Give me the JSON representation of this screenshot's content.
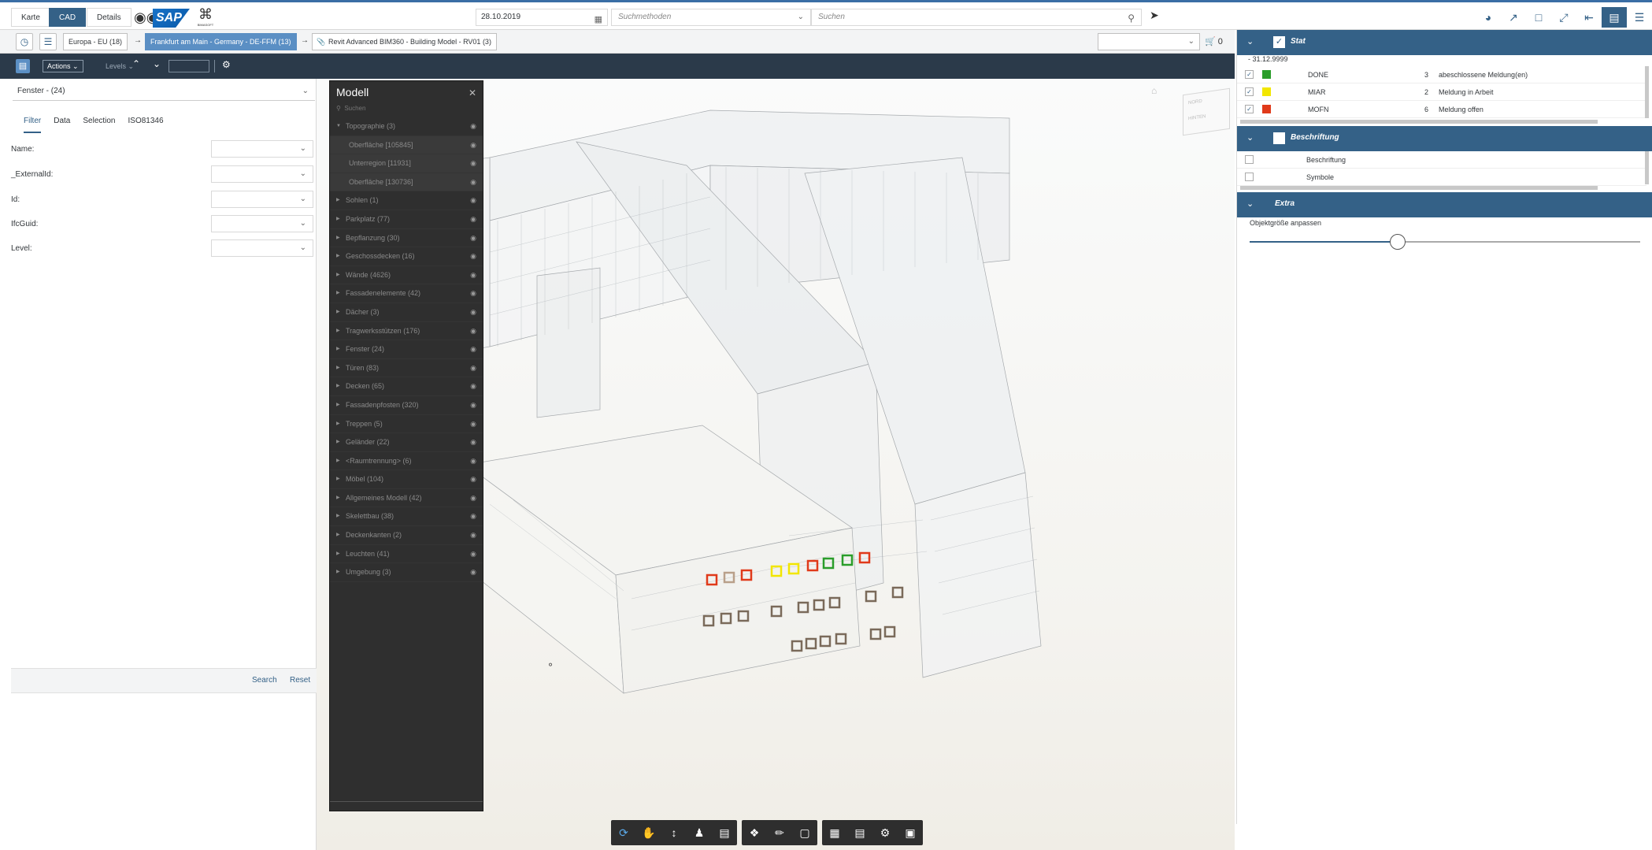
{
  "topbar": {
    "tabs": [
      "Karte",
      "CAD",
      "Details"
    ],
    "sap_logo": "SAP",
    "bim_logo_small": "BIMASOFT",
    "date": "28.10.2019",
    "methods_placeholder": "Suchmethoden",
    "search_placeholder": "Suchen"
  },
  "breadcrumbs": {
    "items": [
      "Europa - EU (18)",
      "Frankfurt am Main - Germany - DE-FFM (13)",
      "Revit Advanced BIM360 - Building Model - RV01 (3)"
    ],
    "cart_count": "0"
  },
  "toolbar3": {
    "actions_label": "Actions",
    "levels_label": "Levels"
  },
  "left_panel": {
    "selected": "Fenster - (24)",
    "tabs": [
      "Filter",
      "Data",
      "Selection",
      "ISO81346"
    ],
    "fields": [
      "Name:",
      "_ExternalId:",
      "Id:",
      "IfcGuid:",
      "Level:"
    ],
    "search_button": "Search",
    "reset_button": "Reset"
  },
  "modell": {
    "title": "Modell",
    "search_placeholder": "Suchen",
    "items": [
      {
        "label": "Topographie (3)",
        "sub": false
      },
      {
        "label": "Oberfläche [105845]",
        "sub": true
      },
      {
        "label": "Unterregion [11931]",
        "sub": true
      },
      {
        "label": "Oberfläche [130736]",
        "sub": true
      },
      {
        "label": "Sohlen (1)",
        "sub": false
      },
      {
        "label": "Parkplatz (77)",
        "sub": false
      },
      {
        "label": "Bepflanzung (30)",
        "sub": false
      },
      {
        "label": "Geschossdecken (16)",
        "sub": false
      },
      {
        "label": "Wände (4626)",
        "sub": false
      },
      {
        "label": "Fassadenelemente (42)",
        "sub": false
      },
      {
        "label": "Dächer (3)",
        "sub": false
      },
      {
        "label": "Tragwerksstützen (176)",
        "sub": false
      },
      {
        "label": "Fenster (24)",
        "sub": false
      },
      {
        "label": "Türen (83)",
        "sub": false
      },
      {
        "label": "Decken (65)",
        "sub": false
      },
      {
        "label": "Fassadenpfosten (320)",
        "sub": false
      },
      {
        "label": "Treppen (5)",
        "sub": false
      },
      {
        "label": "Geländer (22)",
        "sub": false
      },
      {
        "label": "<Raumtrennung> (6)",
        "sub": false
      },
      {
        "label": "Möbel (104)",
        "sub": false
      },
      {
        "label": "Allgemeines Modell (42)",
        "sub": false
      },
      {
        "label": "Skelettbau (38)",
        "sub": false
      },
      {
        "label": "Deckenkanten (2)",
        "sub": false
      },
      {
        "label": "Leuchten (41)",
        "sub": false
      },
      {
        "label": "Umgebung (3)",
        "sub": false
      }
    ]
  },
  "navcube": {
    "top": "NORD",
    "side": "HINTEN"
  },
  "right_panel": {
    "stat": {
      "label": "Stat",
      "date": "- 31.12.9999",
      "rows": [
        {
          "code": "DONE",
          "count": "3",
          "desc": "abeschlossene Meldung(en)",
          "color": "#2a9d2a"
        },
        {
          "code": "MIAR",
          "count": "2",
          "desc": "Meldung in Arbeit",
          "color": "#f2e600"
        },
        {
          "code": "MOFN",
          "count": "6",
          "desc": "Meldung offen",
          "color": "#e03a1a"
        }
      ]
    },
    "beschriftung": {
      "label": "Beschriftung",
      "rows": [
        "Beschriftung",
        "Symbole"
      ]
    },
    "extra": {
      "label": "Extra",
      "slider_label": "Objektgröße anpassen",
      "slider_value": 0.38
    }
  },
  "colors": {
    "brand": "#346187",
    "done": "#2a9d2a",
    "in_progress": "#f2e600",
    "open": "#e03a1a"
  }
}
